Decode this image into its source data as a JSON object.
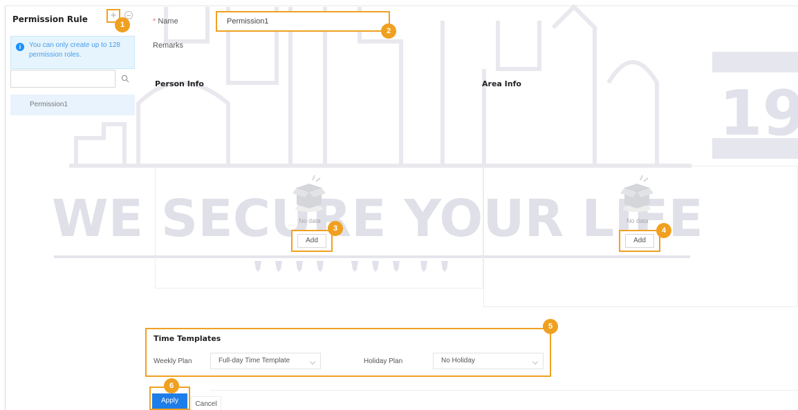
{
  "sidebar": {
    "title": "Permission Rule",
    "add_label": "+",
    "info_text": "You can only create up to 128 permission roles.",
    "search": {
      "placeholder": ""
    },
    "rules": [
      {
        "label": "Permission1"
      }
    ]
  },
  "form": {
    "name_required_mark": "*",
    "name_label": "Name",
    "name_value": "Permission1",
    "remarks_label": "Remarks"
  },
  "person_info": {
    "title": "Person Info",
    "empty_text": "No data",
    "add_label": "Add"
  },
  "area_info": {
    "title": "Area Info",
    "empty_text": "No data",
    "add_label": "Add"
  },
  "time_templates": {
    "title": "Time Templates",
    "weekly_plan_label": "Weekly Plan",
    "weekly_plan_value": "Full-day Time Template",
    "holiday_plan_label": "Holiday Plan",
    "holiday_plan_value": "No Holiday"
  },
  "actions": {
    "apply_label": "Apply",
    "cancel_label": "Cancel"
  },
  "markers": [
    "1",
    "2",
    "3",
    "4",
    "5",
    "6"
  ],
  "watermark": {
    "text": "WE SECURE YOUR LIFE",
    "number": "19"
  },
  "colors": {
    "highlight": "#f0a020",
    "primary": "#1e7de8",
    "info_background": "#e6f4fd",
    "watermark": "#b8b9c8"
  },
  "icons": {
    "add": "plus-icon",
    "delete": "minus-circle-icon",
    "info": "info-icon",
    "search": "search-icon",
    "empty": "empty-box-icon",
    "dropdown": "chevron-down-icon"
  }
}
